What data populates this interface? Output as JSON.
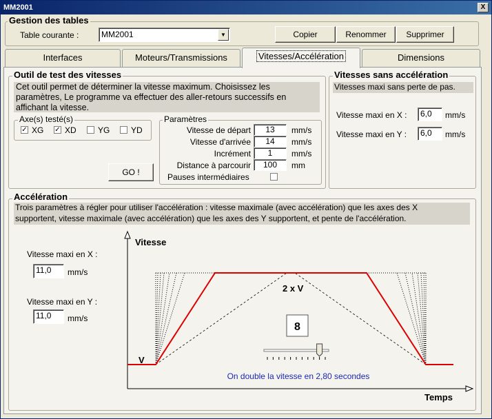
{
  "window": {
    "title": "MM2001",
    "close_label": "X"
  },
  "gestion": {
    "title": "Gestion des tables",
    "table_label": "Table courante :",
    "table_value": "MM2001",
    "buttons": {
      "copier": "Copier",
      "renommer": "Renommer",
      "supprimer": "Supprimer"
    }
  },
  "tabs": [
    "Interfaces",
    "Moteurs/Transmissions",
    "Vitesses/Accélération",
    "Dimensions"
  ],
  "outil": {
    "title": "Outil de test des vitesses",
    "description": [
      "Cet outil permet de déterminer la vitesse maximum. Choisissez les",
      "paramètres, Le programme va effectuer des aller-retours successifs en",
      "affichant la vitesse."
    ],
    "axes_title": "Axe(s) testé(s)",
    "axes": [
      {
        "label": "XG",
        "checked": true,
        "mark": "✓"
      },
      {
        "label": "XD",
        "checked": true,
        "mark": "✓"
      },
      {
        "label": "YG",
        "checked": false,
        "mark": ""
      },
      {
        "label": "YD",
        "checked": false,
        "mark": ""
      }
    ],
    "go_label": "GO !",
    "params_title": "Paramètres",
    "params": [
      {
        "label": "Vitesse de départ",
        "value": "13",
        "unit": "mm/s"
      },
      {
        "label": "Vitesse d'arrivée",
        "value": "14",
        "unit": "mm/s"
      },
      {
        "label": "Incrément",
        "value": "1",
        "unit": "mm/s"
      },
      {
        "label": "Distance à parcourir",
        "value": "100",
        "unit": "mm"
      }
    ],
    "pauses_label": "Pauses intermédiaires"
  },
  "sans_accel": {
    "title": "Vitesses sans accélération",
    "subtitle": "Vitesses maxi sans perte de pas.",
    "vx_label": "Vitesse maxi en X :",
    "vx_value": "6,0",
    "vy_label": "Vitesse maxi en Y :",
    "vy_value": "6,0",
    "unit": "mm/s"
  },
  "acceleration": {
    "title": "Accélération",
    "description": [
      "Trois paramètres à régler pour utiliser l'accélération : vitesse maximale (avec accélération) que les axes des X",
      "supportent, vitesse maximale (avec accélération) que les axes des Y supportent, et pente de l'accélération."
    ],
    "vx_label": "Vitesse maxi en X :",
    "vx_value": "11,0",
    "vy_label": "Vitesse maxi en Y :",
    "vy_value": "11,0",
    "unit": "mm/s"
  },
  "graph": {
    "y_label": "Vitesse",
    "x_label": "Temps",
    "v_label": "V",
    "top_label": "2 x V",
    "slope_value": "8",
    "slider_fraction": 0.9,
    "caption": "On double la vitesse en 2,80 secondes",
    "accent_color": "#dd0000",
    "caption_color": "#1a28b4"
  }
}
